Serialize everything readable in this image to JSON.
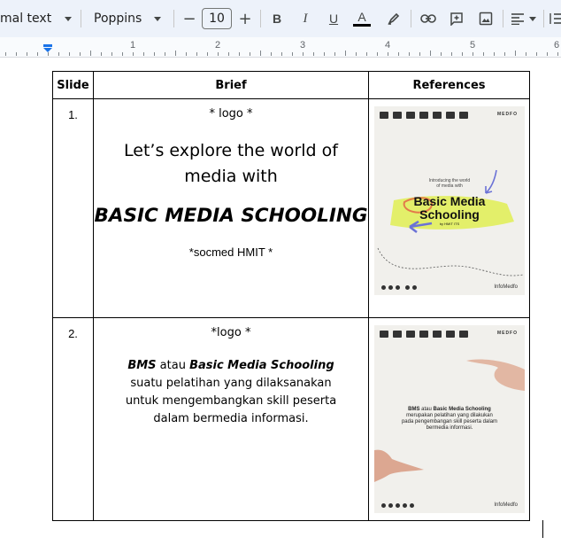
{
  "toolbar": {
    "style_label": "mal text",
    "font_name": "Poppins",
    "font_size": "10",
    "minus": "−",
    "plus": "+",
    "bold": "B",
    "italic": "I",
    "underline": "U",
    "text_color": "A"
  },
  "ruler": {
    "numbers": [
      "1",
      "2",
      "3",
      "4",
      "5",
      "6"
    ]
  },
  "table": {
    "headers": {
      "slide": "Slide",
      "brief": "Brief",
      "references": "References"
    },
    "rows": [
      {
        "slide": "1.",
        "logo": "* logo *",
        "line1": "Let’s explore the world of",
        "line2": "media with",
        "title": "BASIC MEDIA SCHOOLING",
        "socmed": "*socmed HMIT *",
        "ref": {
          "brand": "MEDFO",
          "intro1": "Introducing the world",
          "intro2": "of media with",
          "title1": "Basic Media",
          "title2": "Schooling",
          "sub": "by HMIT ITS",
          "footer_brand": "InfoMedfo"
        }
      },
      {
        "slide": "2.",
        "logo": "*logo *",
        "bms": "BMS",
        "atau": " atau ",
        "bms_full": "Basic Media Schooling",
        "line1": "suatu pelatihan yang dilaksanakan",
        "line2": "untuk mengembangkan skill peserta",
        "line3": "dalam bermedia informasi.",
        "ref": {
          "brand": "MEDFO",
          "t_bms": "BMS",
          "t_atau": " atau ",
          "t_full": "Basic Media Schooling",
          "t_line1": "merupakan pelatihan yang dilakukan",
          "t_line2": "pada pengembangan skill peserta dalam",
          "t_line3": "bermedia informasi.",
          "footer_brand": "InfoMedfo"
        }
      }
    ]
  },
  "colors": {
    "toolbar_bg": "#edf2fa",
    "highlight": "#e3ef6a",
    "accent_blue": "#6b72d6",
    "text_color_bar": "#000000"
  }
}
